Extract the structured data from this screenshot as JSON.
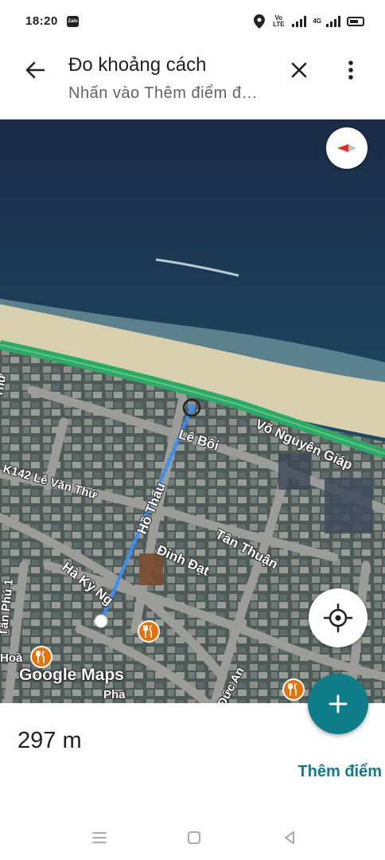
{
  "status_bar": {
    "time": "18:20",
    "zalo_label": "Zalo",
    "volte": "Vo LTE",
    "network": "4G",
    "icons": [
      "location-icon",
      "signal-icon",
      "battery-icon"
    ]
  },
  "app_bar": {
    "title": "Đo khoảng cách",
    "subtitle": "Nhấn vào Thêm điểm đ…",
    "icons": [
      "back-arrow-icon",
      "close-icon",
      "more-vert-icon"
    ]
  },
  "map": {
    "roads": {
      "vo_nguyen_giap": "Võ Nguyên Giáp",
      "le_boi": "Lê Bôi",
      "k142_le_van_thu": "K142 Lê Văn Thứ",
      "ho_thau": "Hồ Thấu",
      "tan_thuan": "Tân Thuận",
      "dinh_dat": "Đinh Đạt",
      "ha_ky_ng": "Hà Kỳ Ng",
      "tan_phu_1": "Tân Phú 1",
      "duc_an": "Đức An",
      "pha": "Pha",
      "hoa": "Hoà",
      "thu": "Thứ"
    },
    "logo": "Google Maps",
    "colors": {
      "sea": "#1b2d44",
      "beach": "#d8cfae",
      "measure_line": "#3b8ff0",
      "coast_road": "#2ea866",
      "restaurant": "#e8710a"
    },
    "icons": [
      "compass-icon",
      "my-location-icon",
      "restaurant-icon"
    ]
  },
  "measurement": {
    "distance": "297 m",
    "add_point_label": "Thêm điểm"
  },
  "fab": {
    "icon": "plus-icon"
  },
  "nav_bar": {
    "icons": [
      "recent-apps-icon",
      "home-icon",
      "back-icon"
    ]
  }
}
